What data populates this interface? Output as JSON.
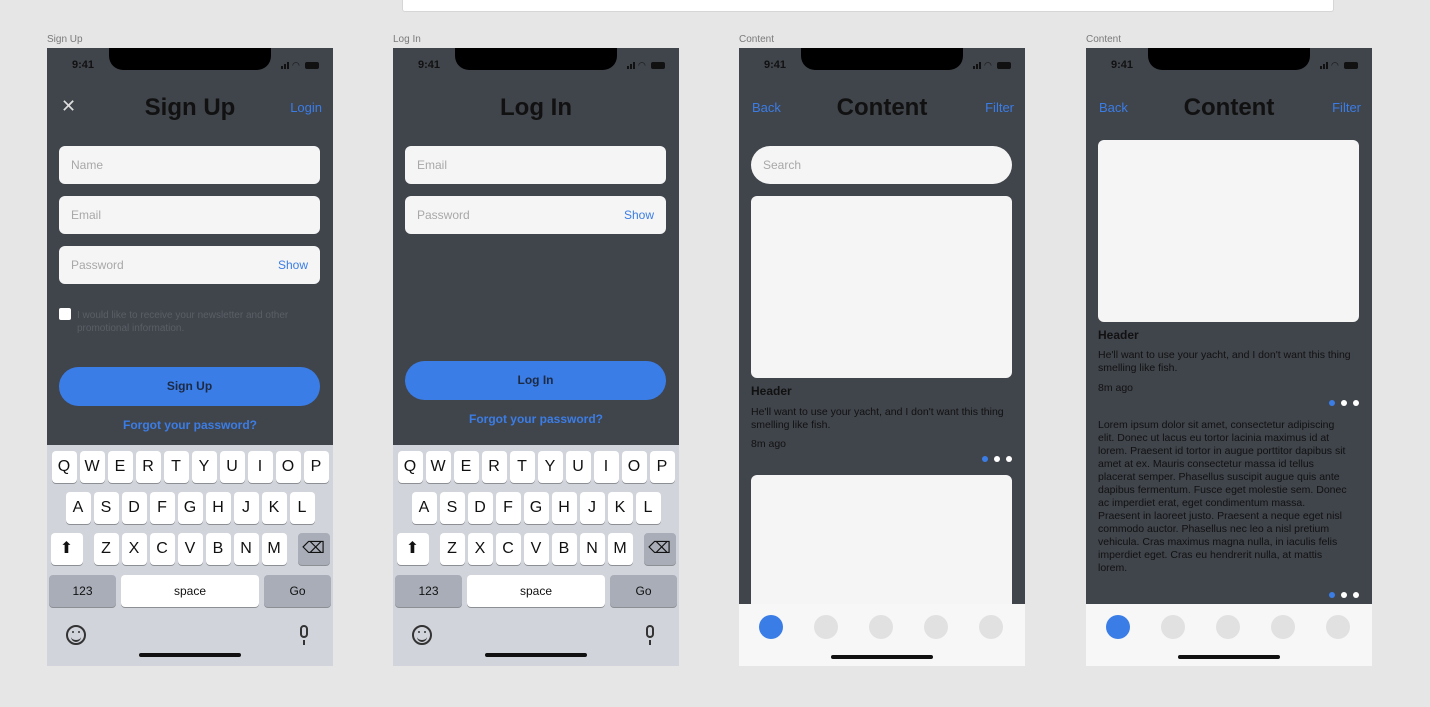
{
  "frames": {
    "signup_label": "Sign Up",
    "login_label": "Log In",
    "content1_label": "Content",
    "content2_label": "Content"
  },
  "status": {
    "time": "9:41"
  },
  "signup": {
    "title": "Sign Up",
    "close": "✕",
    "login_link": "Login",
    "name_placeholder": "Name",
    "email_placeholder": "Email",
    "password_placeholder": "Password",
    "show": "Show",
    "newsletter": "I would like to receive your newsletter and other promotional information.",
    "button": "Sign Up",
    "forgot": "Forgot your password?"
  },
  "login": {
    "title": "Log In",
    "email_placeholder": "Email",
    "password_placeholder": "Password",
    "show": "Show",
    "button": "Log In",
    "forgot": "Forgot your password?"
  },
  "keyboard": {
    "row1": [
      "Q",
      "W",
      "E",
      "R",
      "T",
      "Y",
      "U",
      "I",
      "O",
      "P"
    ],
    "row2": [
      "A",
      "S",
      "D",
      "F",
      "G",
      "H",
      "J",
      "K",
      "L"
    ],
    "row3": [
      "Z",
      "X",
      "C",
      "V",
      "B",
      "N",
      "M"
    ],
    "k123": "123",
    "space": "space",
    "go": "Go",
    "shift": "⬆",
    "backspace": "⌫"
  },
  "content": {
    "title": "Content",
    "back": "Back",
    "filter": "Filter",
    "search_placeholder": "Search",
    "card_header": "Header",
    "card_body": "He'll want to use your yacht, and I don't want this thing smelling like fish.",
    "card_time": "8m ago",
    "lorem": "Lorem ipsum dolor sit amet, consectetur adipiscing elit. Donec ut lacus eu tortor lacinia maximus id at lorem. Praesent id tortor in augue porttitor dapibus sit amet at ex. Mauris consectetur massa id tellus placerat semper. Phasellus suscipit augue quis ante dapibus fermentum. Fusce eget molestie sem. Donec ac imperdiet erat, eget condimentum massa. Praesent in laoreet justo. Praesent a neque eget nisl commodo auctor. Phasellus nec leo a nisl pretium vehicula. Cras maximus magna nulla, in iaculis felis imperdiet eget. Cras eu hendrerit nulla, at mattis lorem."
  },
  "colors": {
    "accent": "#3b7de6",
    "phone_bg": "#40444b",
    "field_bg": "#f5f5f5",
    "keyboard_bg": "#d1d4db"
  }
}
